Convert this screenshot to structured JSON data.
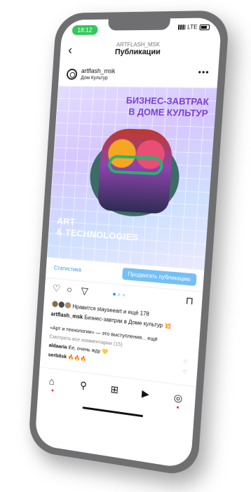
{
  "status_bar": {
    "time": "18:12",
    "network": "LTE"
  },
  "header": {
    "account_name": "ARTFLASH_MSK",
    "title": "Публикации"
  },
  "post": {
    "account": "artflash_msk",
    "location": "Дом Культур",
    "image": {
      "headline_line1": "БИЗНЕС-ЗАВТРАК",
      "headline_line2": "В ДОМЕ КУЛЬТУР",
      "footer_line1": "ART",
      "footer_line2": "& TECHNOLOGIES"
    },
    "stats_link": "Статистика",
    "promote_button": "Продвигать публикацию",
    "likes_text": "Нравится stayseeart и ещё 178",
    "caption_user": "artflash_msk",
    "caption_text": "Бизнес-завтрак в Доме культур 💥",
    "description": "«Арт и технологии» — это выступления... ещё",
    "view_comments": "Смотреть все комментарии (15)",
    "comments": [
      {
        "user": "aldaaria",
        "text": "Ее, очень жду 💛"
      },
      {
        "user": "serbitsk",
        "text": "🔥🔥🔥"
      }
    ]
  },
  "icons": {
    "back": "chevron-left-icon",
    "more": "more-icon",
    "like": "heart-icon",
    "comment": "comment-icon",
    "share": "send-icon",
    "save": "bookmark-icon",
    "nav": [
      "home-icon",
      "search-icon",
      "add-icon",
      "reels-icon",
      "profile-icon"
    ]
  },
  "colors": {
    "accent": "#3897f0",
    "headline": "#7a3fd6",
    "status_pill": "#34c759"
  }
}
